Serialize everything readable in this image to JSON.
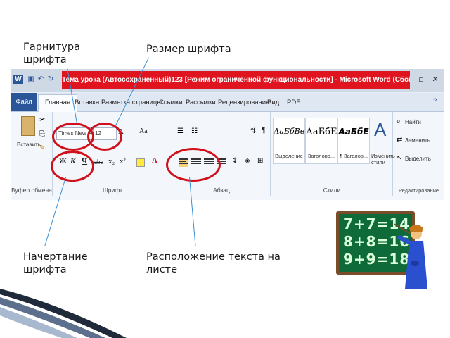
{
  "callouts": {
    "typeface": [
      "Гарнитура",
      "шрифта"
    ],
    "size": "Размер шрифта",
    "style": [
      "Начертание",
      "шрифта"
    ],
    "align": [
      "Расположение текста на",
      "листе"
    ]
  },
  "window": {
    "title": "Тема урока (Автосохраненный)123 [Режим ограниченной функциональности] - Microsoft Word (Сбой активации продукта)",
    "app_letter": "W"
  },
  "tabs": [
    "Файл",
    "Главная",
    "Вставка",
    "Разметка страницы",
    "Ссылки",
    "Рассылки",
    "Рецензирование",
    "Вид",
    "PDF"
  ],
  "ribbon": {
    "clipboard": {
      "paste": "Вставить",
      "label": "Буфер обмена"
    },
    "font": {
      "name": "Times New Ro",
      "size": "12",
      "grow": "A",
      "case": "Aa",
      "bold": "Ж",
      "italic": "К",
      "underline": "Ч",
      "strike": "abc",
      "sub": "x₂",
      "sup": "x²",
      "color": "A",
      "label": "Шрифт"
    },
    "paragraph": {
      "pilcrow": "¶",
      "label": "Абзац"
    },
    "styles": {
      "items": [
        {
          "sample": "АаБбВвГ",
          "name": "Выделение"
        },
        {
          "sample": "АаБбЕ",
          "name": "Заголово..."
        },
        {
          "sample": "АаБбЕ",
          "name": "¶ Заголов..."
        }
      ],
      "change": "Изменить стили",
      "big_a": "A",
      "label": "Стили"
    },
    "editing": {
      "find": "Найти",
      "replace": "Заменить",
      "select": "Выделить",
      "label": "Редактирование"
    }
  },
  "chalkboard": [
    "7+7=14",
    "8+8=16",
    "9+9=18"
  ],
  "colors": {
    "accent_red": "#e0141e",
    "file_tab": "#2a5699",
    "ring": "#d0101a",
    "leader": "#3a8fd6"
  }
}
